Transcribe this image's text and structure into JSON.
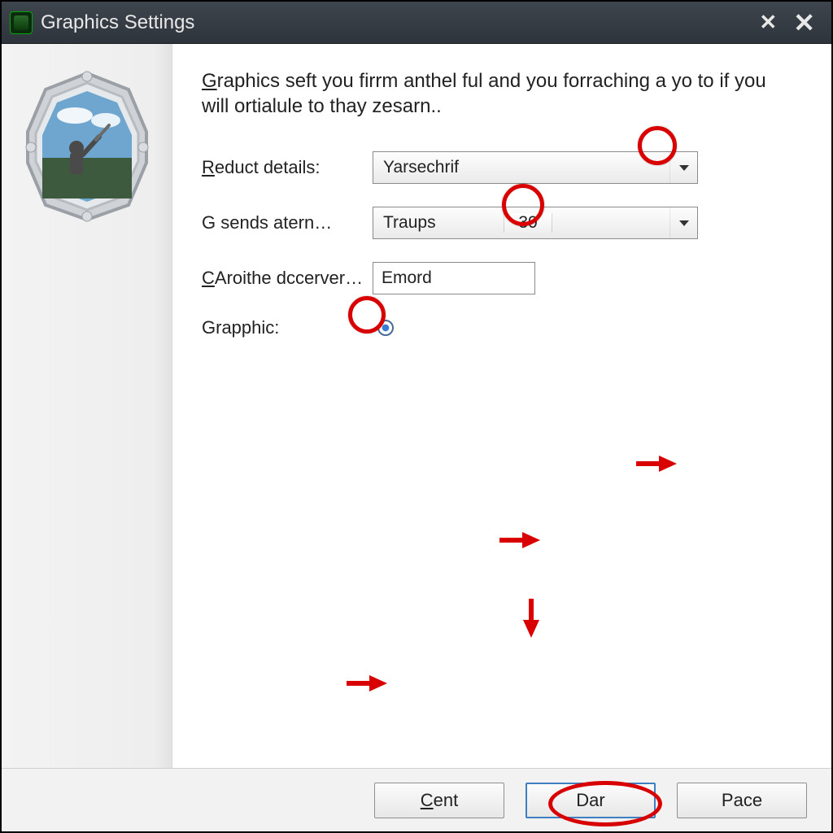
{
  "titlebar": {
    "title": "Graphics Settings"
  },
  "description": "Graphics seft you firrm anthel ful and you forraching a yo to if you will ortialule to thay zesarn..",
  "form": {
    "reduct_label": "Reduct details:",
    "reduct_value": "Yarsechrif",
    "gsends_label": "G sends atern…",
    "gsends_value": "Traups",
    "gsends_number": "30",
    "caroithe_label": "CAroithe dccerver…",
    "caroithe_value": "Emord",
    "grapphic_label": "Grapphic:"
  },
  "buttons": {
    "cent": "Cent",
    "dar": "Dar",
    "pace": "Pace"
  }
}
